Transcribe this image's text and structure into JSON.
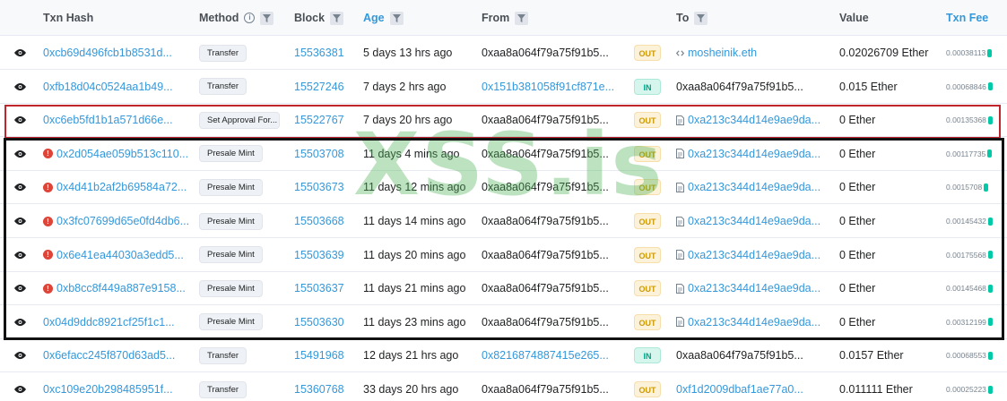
{
  "header": {
    "txn_hash": "Txn Hash",
    "method": "Method",
    "block": "Block",
    "age": "Age",
    "from": "From",
    "to": "To",
    "value": "Value",
    "txn_fee": "Txn Fee"
  },
  "colors": {
    "link": "#3498db",
    "out": "#cc9a06",
    "in": "#00a186",
    "error": "#de4437",
    "red_box": "#c0252d",
    "black_box": "#111111",
    "watermark": "#4eb258"
  },
  "watermark": "XSS.is",
  "rows": [
    {
      "hash": "0xcb69d496fcb1b8531d...",
      "error": false,
      "method": "Transfer",
      "block": "15536381",
      "age": "5 days 13 hrs ago",
      "from": "0xaa8a064f79a75f91b5...",
      "from_link": false,
      "dir": "OUT",
      "to": "mosheinik.eth",
      "to_icon": "code-icon",
      "to_link": true,
      "value": "0.02026709 Ether",
      "fee": "0.00038113"
    },
    {
      "hash": "0xfb18d04c0524aa1b49...",
      "error": false,
      "method": "Transfer",
      "block": "15527246",
      "age": "7 days 2 hrs ago",
      "from": "0x151b381058f91cf871e...",
      "from_link": true,
      "dir": "IN",
      "to": "0xaa8a064f79a75f91b5...",
      "to_icon": "",
      "to_link": false,
      "value": "0.015 Ether",
      "fee": "0.00068846"
    },
    {
      "hash": "0xc6eb5fd1b1a571d66e...",
      "error": false,
      "method": "Set Approval For...",
      "block": "15522767",
      "age": "7 days 20 hrs ago",
      "from": "0xaa8a064f79a75f91b5...",
      "from_link": false,
      "dir": "OUT",
      "to": "0xa213c344d14e9ae9da...",
      "to_icon": "contract-icon",
      "to_link": true,
      "value": "0 Ether",
      "fee": "0.00135368"
    },
    {
      "hash": "0x2d054ae059b513c110...",
      "error": true,
      "method": "Presale Mint",
      "block": "15503708",
      "age": "11 days 4 mins ago",
      "from": "0xaa8a064f79a75f91b5...",
      "from_link": false,
      "dir": "OUT",
      "to": "0xa213c344d14e9ae9da...",
      "to_icon": "contract-icon",
      "to_link": true,
      "value": "0 Ether",
      "fee": "0.00117735"
    },
    {
      "hash": "0x4d41b2af2b69584a72...",
      "error": true,
      "method": "Presale Mint",
      "block": "15503673",
      "age": "11 days 12 mins ago",
      "from": "0xaa8a064f79a75f91b5...",
      "from_link": false,
      "dir": "OUT",
      "to": "0xa213c344d14e9ae9da...",
      "to_icon": "contract-icon",
      "to_link": true,
      "value": "0 Ether",
      "fee": "0.0015708"
    },
    {
      "hash": "0x3fc07699d65e0fd4db6...",
      "error": true,
      "method": "Presale Mint",
      "block": "15503668",
      "age": "11 days 14 mins ago",
      "from": "0xaa8a064f79a75f91b5...",
      "from_link": false,
      "dir": "OUT",
      "to": "0xa213c344d14e9ae9da...",
      "to_icon": "contract-icon",
      "to_link": true,
      "value": "0 Ether",
      "fee": "0.00145432"
    },
    {
      "hash": "0x6e41ea44030a3edd5...",
      "error": true,
      "method": "Presale Mint",
      "block": "15503639",
      "age": "11 days 20 mins ago",
      "from": "0xaa8a064f79a75f91b5...",
      "from_link": false,
      "dir": "OUT",
      "to": "0xa213c344d14e9ae9da...",
      "to_icon": "contract-icon",
      "to_link": true,
      "value": "0 Ether",
      "fee": "0.00175568"
    },
    {
      "hash": "0xb8cc8f449a887e9158...",
      "error": true,
      "method": "Presale Mint",
      "block": "15503637",
      "age": "11 days 21 mins ago",
      "from": "0xaa8a064f79a75f91b5...",
      "from_link": false,
      "dir": "OUT",
      "to": "0xa213c344d14e9ae9da...",
      "to_icon": "contract-icon",
      "to_link": true,
      "value": "0 Ether",
      "fee": "0.00145468"
    },
    {
      "hash": "0x04d9ddc8921cf25f1c1...",
      "error": false,
      "method": "Presale Mint",
      "block": "15503630",
      "age": "11 days 23 mins ago",
      "from": "0xaa8a064f79a75f91b5...",
      "from_link": false,
      "dir": "OUT",
      "to": "0xa213c344d14e9ae9da...",
      "to_icon": "contract-icon",
      "to_link": true,
      "value": "0 Ether",
      "fee": "0.00312199"
    },
    {
      "hash": "0x6efacc245f870d63ad5...",
      "error": false,
      "method": "Transfer",
      "block": "15491968",
      "age": "12 days 21 hrs ago",
      "from": "0x8216874887415e265...",
      "from_link": true,
      "dir": "IN",
      "to": "0xaa8a064f79a75f91b5...",
      "to_icon": "",
      "to_link": false,
      "value": "0.0157 Ether",
      "fee": "0.00068553"
    },
    {
      "hash": "0xc109e20b298485951f...",
      "error": false,
      "method": "Transfer",
      "block": "15360768",
      "age": "33 days 20 hrs ago",
      "from": "0xaa8a064f79a75f91b5...",
      "from_link": false,
      "dir": "OUT",
      "to": "0xf1d2009dbaf1ae77a0...",
      "to_icon": "",
      "to_link": true,
      "value": "0.011111 Ether",
      "fee": "0.00025223"
    }
  ]
}
